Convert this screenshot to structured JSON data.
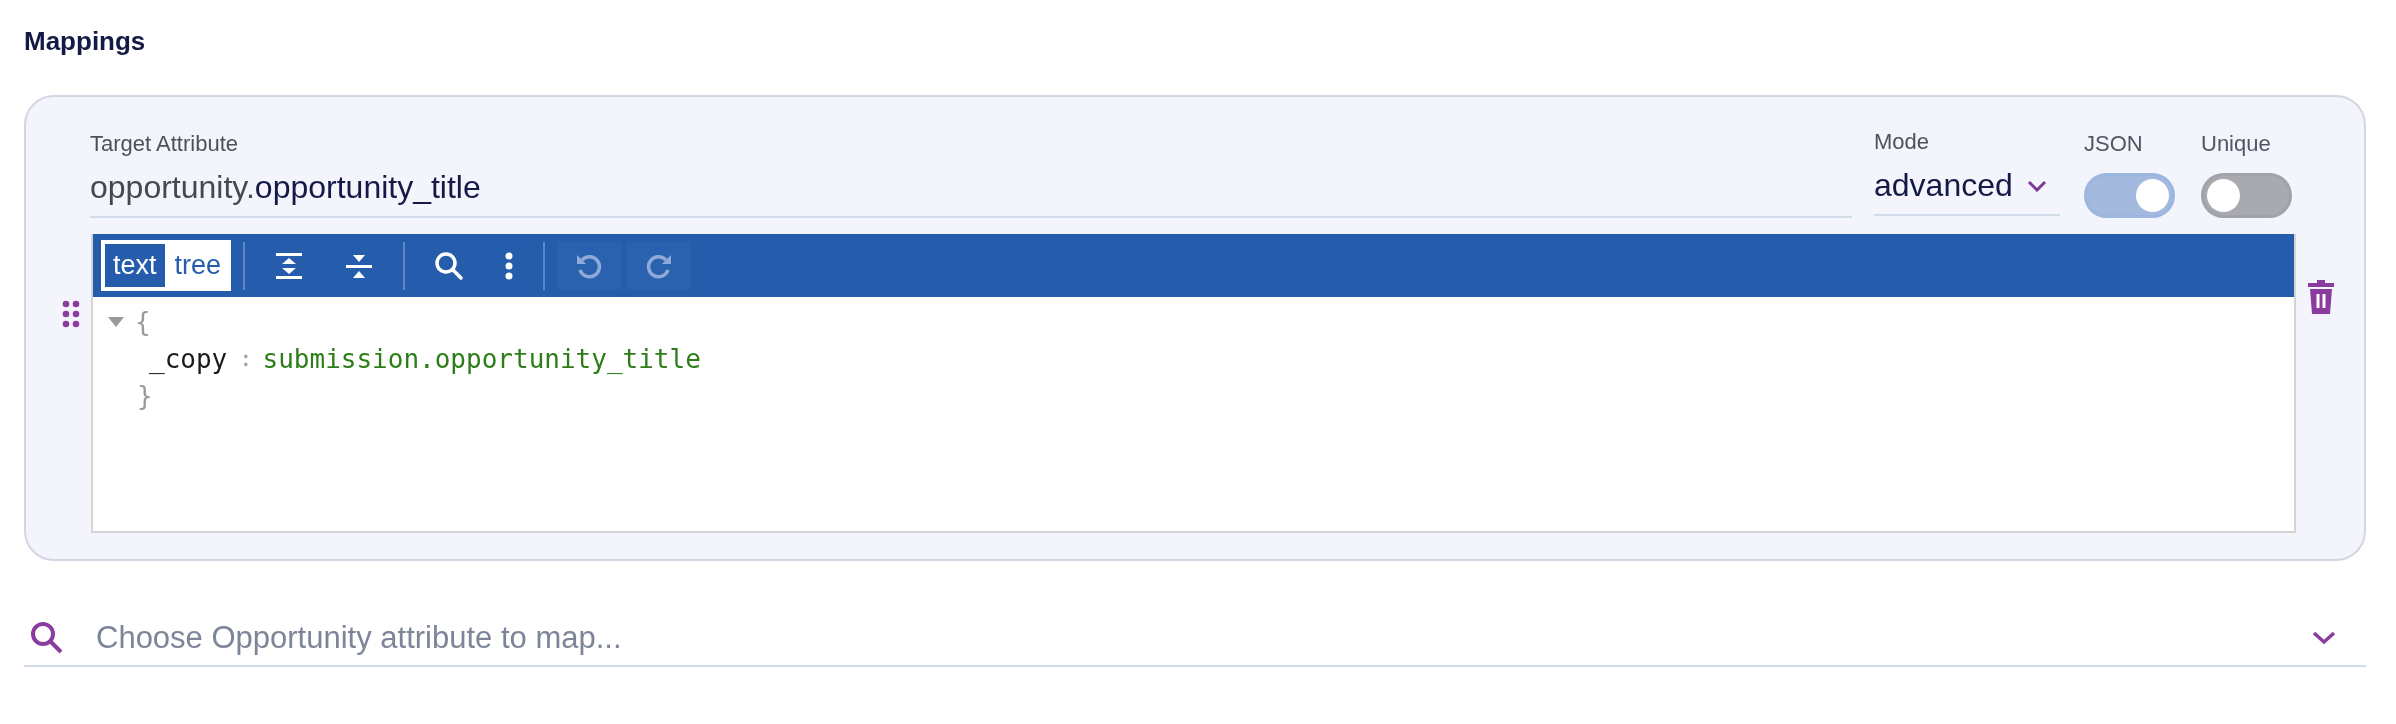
{
  "heading": "Mappings",
  "mapping": {
    "target": {
      "label": "Target Attribute",
      "value_prefix": "opportunity.",
      "value": "opportunity_title"
    },
    "mode": {
      "label": "Mode",
      "value": "advanced"
    },
    "toggles": [
      {
        "label": "JSON",
        "on": true
      },
      {
        "label": "Unique",
        "on": false
      }
    ],
    "editor": {
      "view_modes": [
        {
          "label": "text",
          "selected": true
        },
        {
          "label": "tree",
          "selected": false
        }
      ],
      "tools": [
        {
          "kind": "expand-all",
          "disabled": false
        },
        {
          "kind": "collapse-all",
          "disabled": false
        },
        {
          "kind": "separator"
        },
        {
          "kind": "search",
          "disabled": false
        },
        {
          "kind": "more",
          "disabled": false
        },
        {
          "kind": "separator"
        },
        {
          "kind": "undo",
          "disabled": true
        },
        {
          "kind": "redo",
          "disabled": true
        }
      ],
      "code": {
        "expanded": true,
        "open": "{",
        "key": "_copy",
        "separator": ":",
        "value": "submission.opportunity_title",
        "close": "}"
      }
    }
  },
  "search": {
    "placeholder": "Choose Opportunity attribute to map..."
  }
}
